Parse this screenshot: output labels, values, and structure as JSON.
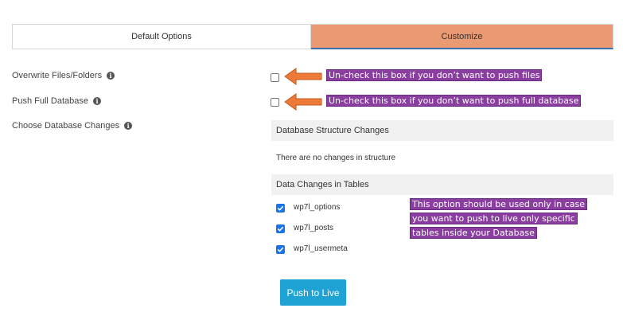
{
  "tabs": {
    "default_label": "Default Options",
    "customize_label": "Customize"
  },
  "options": {
    "overwrite_label": "Overwrite Files/Folders",
    "push_db_label": "Push Full Database",
    "choose_db_label": "Choose Database Changes"
  },
  "callouts": {
    "files": "Un-check this box if you don’t want to push files",
    "database": "Un-check this box if you don’t want to push full database",
    "tables_line1": "This option should be used only in case",
    "tables_line2": "you want to push to live only specific",
    "tables_line3": "tables inside your Database"
  },
  "structure": {
    "heading": "Database Structure Changes",
    "message": "There are no changes in structure"
  },
  "data_changes": {
    "heading": "Data Changes in Tables",
    "tables": [
      {
        "name": "wp7l_options",
        "checked": true
      },
      {
        "name": "wp7l_posts",
        "checked": true
      },
      {
        "name": "wp7l_usermeta",
        "checked": true
      }
    ]
  },
  "actions": {
    "push_label": "Push to Live"
  },
  "colors": {
    "customize_tab": "#e99a72",
    "arrow": "#ee7a3a",
    "callout_bg": "#8a3fa0",
    "button": "#1fa3d4",
    "checkbox_checked": "#1a73e8"
  }
}
